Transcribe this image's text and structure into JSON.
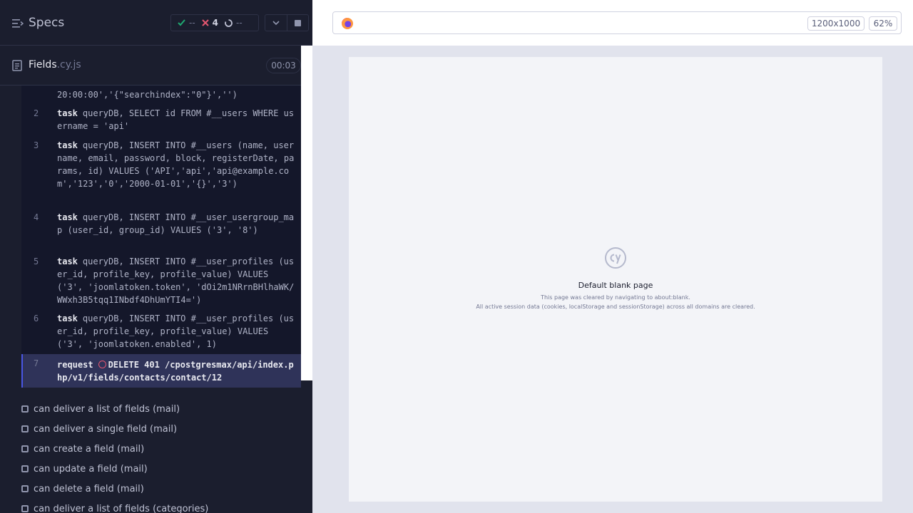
{
  "header": {
    "title": "Specs",
    "stats": {
      "passed": "--",
      "failed": "4",
      "pending": "--"
    }
  },
  "file": {
    "name": "Fields",
    "ext": ".cy.js",
    "duration": "00:03"
  },
  "commands": [
    {
      "num": "",
      "keyword": "",
      "text": "20:00:00','{\"searchindex\":\"0\"}','')"
    },
    {
      "num": "2",
      "keyword": "task",
      "text": "queryDB, SELECT id FROM #__users WHERE username = 'api'"
    },
    {
      "num": "3",
      "keyword": "task",
      "text": "queryDB, INSERT INTO #__users (name, username, email, password, block, registerDate, params, id) VALUES ('API','api','api@example.com','123','0','2000-01-01','{}','3')"
    },
    {
      "num": "4",
      "keyword": "task",
      "text": "queryDB, INSERT INTO #__user_usergroup_map (user_id, group_id) VALUES ('3', '8')"
    },
    {
      "num": "5",
      "keyword": "task",
      "text": "queryDB, INSERT INTO #__user_profiles (user_id, profile_key, profile_value) VALUES ('3', 'joomlatoken.token', 'dOi2m1NRrnBHlhaWK/WWxh3B5tqq1INbdf4DhUmYTI4=')"
    },
    {
      "num": "6",
      "keyword": "task",
      "text": "queryDB, INSERT INTO #__user_profiles (user_id, profile_key, profile_value) VALUES ('3', 'joomlatoken.enabled', 1)"
    },
    {
      "num": "7",
      "keyword": "request",
      "text": "DELETE 401 /cpostgresmax/api/index.php/v1/fields/contacts/contact/12"
    }
  ],
  "tests": [
    "can deliver a list of fields (mail)",
    "can deliver a single field (mail)",
    "can create a field (mail)",
    "can update a field (mail)",
    "can delete a field (mail)",
    "can deliver a list of fields (categories)"
  ],
  "browser": {
    "viewport_size": "1200x1000",
    "zoom": "62%"
  },
  "blank_page": {
    "title": "Default blank page",
    "line1": "This page was cleared by navigating to about:blank.",
    "line2": "All active session data (cookies, localStorage and sessionStorage) across all domains are cleared."
  },
  "icons": {
    "specs": "list-icon",
    "pass": "check-icon",
    "fail": "x-icon",
    "pending": "spinner-icon",
    "dropdown": "chevron-down-icon",
    "stop": "stop-icon",
    "file": "file-icon",
    "browser": "firefox-icon",
    "logo": "cy-logo-icon"
  },
  "colors": {
    "pass": "#1fa971",
    "fail": "#e45770",
    "accent": "#4956e3"
  }
}
